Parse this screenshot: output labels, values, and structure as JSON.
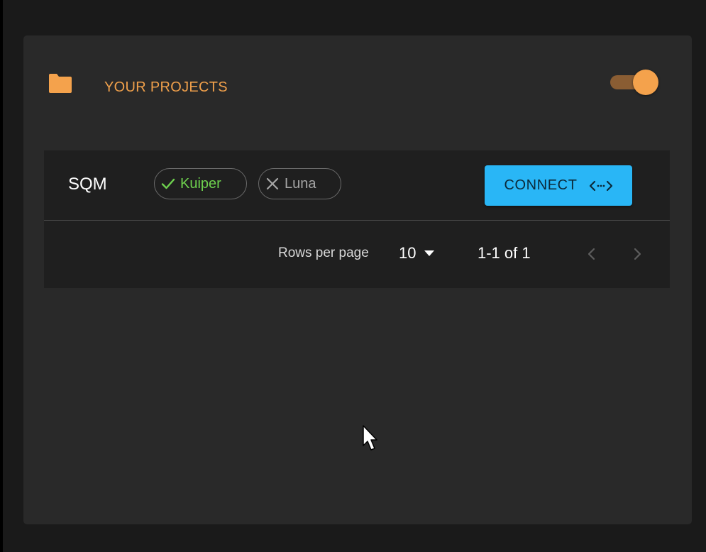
{
  "card": {
    "title": "YOUR PROJECTS",
    "icon": "folder-icon",
    "accent_color": "#f0a04b",
    "toggle_on": true
  },
  "projects": [
    {
      "name": "SQM",
      "chips": [
        {
          "label": "Kuiper",
          "status": "enabled",
          "icon": "check-icon",
          "color": "#6ed14e"
        },
        {
          "label": "Luna",
          "status": "disabled",
          "icon": "close-icon",
          "color": "#a6a6a6"
        }
      ],
      "connect_label": "CONNECT",
      "connect_icon": "code-arrows-icon",
      "connect_color": "#29b6f6"
    }
  ],
  "pagination": {
    "rows_per_page_label": "Rows per page",
    "rows_per_page_value": "10",
    "range_text": "1-1 of 1"
  }
}
